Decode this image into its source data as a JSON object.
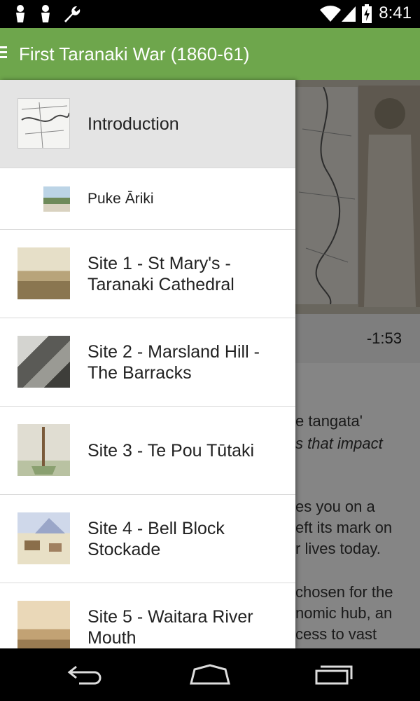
{
  "status_bar": {
    "time": "8:41",
    "icons": [
      "person-pin-icon",
      "person-pin-icon",
      "wrench-icon",
      "wifi-icon",
      "cell-signal-icon",
      "battery-charging-icon"
    ]
  },
  "app_bar": {
    "title": "First Taranaki War (1860-61)",
    "color": "#6ea64c"
  },
  "background": {
    "player_time": "-1:53",
    "text_lines": [
      "e tangata'",
      "s that impact",
      "es you on a",
      "eft its mark on",
      "r lives today.",
      "chosen for the",
      "nomic hub, an",
      "cess to vast"
    ]
  },
  "drawer": {
    "items": [
      {
        "label": "Introduction",
        "selected": true
      },
      {
        "label": "Puke Āriki",
        "selected": false
      },
      {
        "label": "Site 1 - St Mary's -\nTaranaki Cathedral",
        "selected": false
      },
      {
        "label": "Site 2 - Marsland Hill -\nThe Barracks",
        "selected": false
      },
      {
        "label": "Site 3 - Te Pou Tūtaki",
        "selected": false
      },
      {
        "label": "Site 4 - Bell Block\nStockade",
        "selected": false
      },
      {
        "label": "Site 5 - Waitara River\nMouth",
        "selected": false
      }
    ]
  },
  "nav_bar": {
    "buttons": [
      "back-icon",
      "home-icon",
      "recents-icon"
    ]
  }
}
